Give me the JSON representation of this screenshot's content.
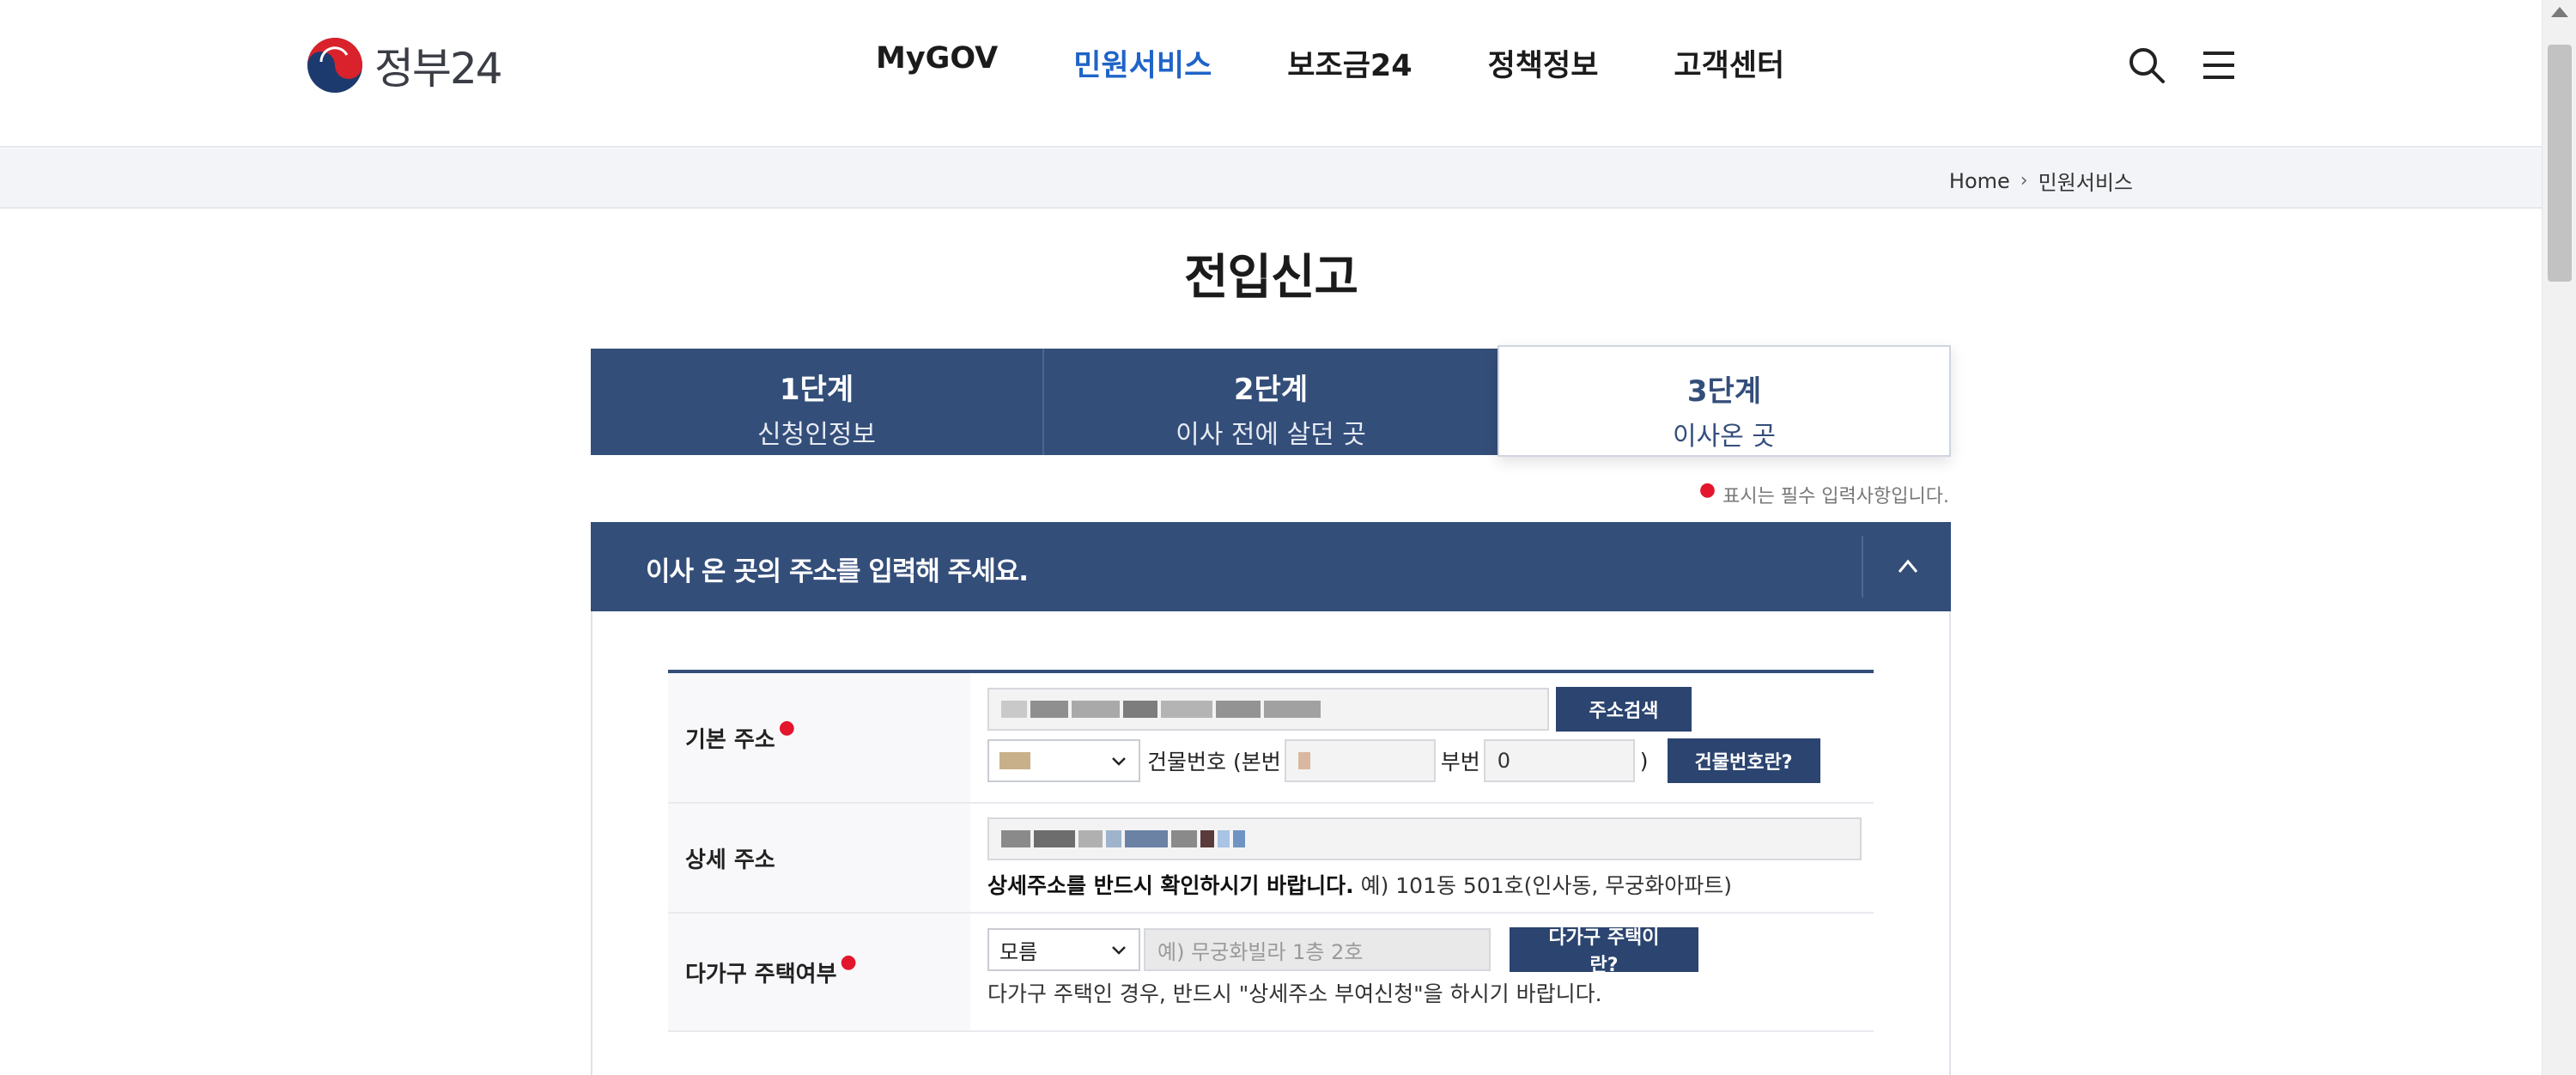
{
  "brand": {
    "name": "정부24"
  },
  "nav": [
    {
      "label": "MyGOV",
      "active": false
    },
    {
      "label": "민원서비스",
      "active": true
    },
    {
      "label": "보조금24",
      "active": false
    },
    {
      "label": "정책정보",
      "active": false
    },
    {
      "label": "고객센터",
      "active": false
    }
  ],
  "breadcrumb": {
    "home": "Home",
    "current": "민원서비스"
  },
  "page": {
    "title": "전입신고"
  },
  "steps": [
    {
      "num": "1단계",
      "label": "신청인정보"
    },
    {
      "num": "2단계",
      "label": "이사 전에 살던 곳"
    },
    {
      "num": "3단계",
      "label": "이사온 곳"
    }
  ],
  "required_note": "표시는 필수 입력사항입니다.",
  "panel": {
    "title": "이사 온 곳의 주소를 입력해 주세요."
  },
  "form": {
    "basic_address": {
      "label": "기본 주소",
      "search_button": "주소검색",
      "building_no_label": "건물번호 (",
      "main_no_label": "본번",
      "sub_no_label": "부번",
      "sub_no_value": "0",
      "close_paren": ")",
      "building_help_button": "건물번호란?"
    },
    "detail_address": {
      "label": "상세 주소",
      "help_bold": "상세주소를 반드시 확인하시기 바랍니다.",
      "help_example": " 예) 101동 501호(인사동, 무궁화아파트)"
    },
    "multi_household": {
      "label": "다가구 주택여부",
      "select_value": "모름",
      "input_placeholder": "예) 무궁화빌라 1층 2호",
      "help_button": "다가구 주택이란?",
      "help_text": "다가구 주택인 경우, 반드시 \"상세주소 부여신청\"을 하시기 바랍니다."
    }
  },
  "colors": {
    "primary": "#344e7a",
    "accent": "#1f64c8",
    "required": "#e3162d"
  }
}
